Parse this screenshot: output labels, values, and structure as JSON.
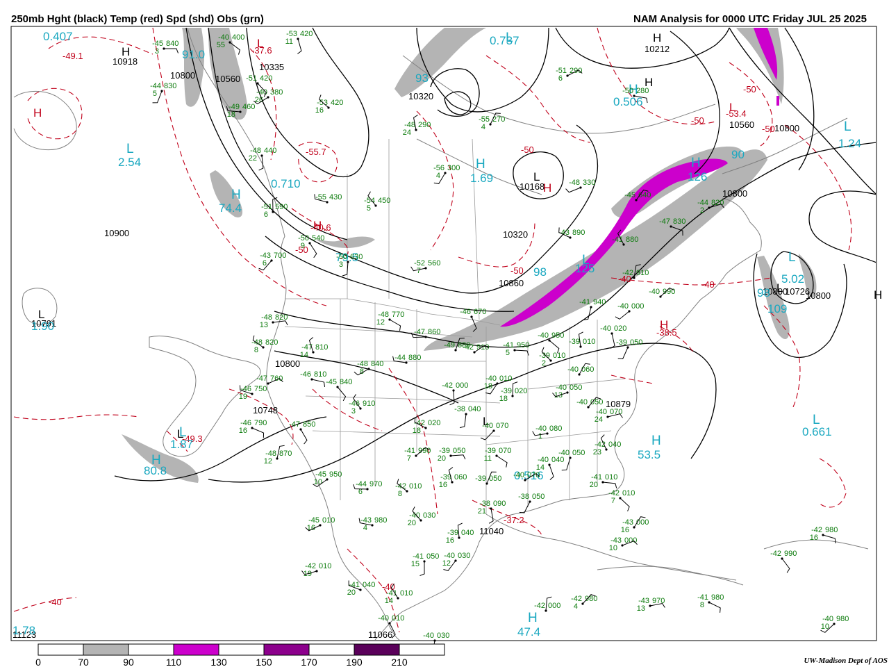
{
  "header": {
    "title_left": "250mb Hght (black) Temp (red) Spd (shd) Obs (grn)",
    "title_right": "NAM Analysis for 0000 UTC Friday  JUL 25 2025"
  },
  "credit": "UW-Madison  Dept of AOS",
  "colors": {
    "height_contour": "#000000",
    "temperature_contour": "#c0001a",
    "speed_label": "#1aa8c0",
    "observation": "#0a7a0a",
    "speed_70_90": "#b4b4b4",
    "speed_110_130": "#cc00cc",
    "speed_150_170": "#8c008c",
    "speed_190_210": "#5a005a",
    "coastline": "#808080"
  },
  "legend": {
    "ticks": [
      "0",
      "70",
      "90",
      "110",
      "130",
      "150",
      "170",
      "190",
      "210"
    ],
    "bins": [
      {
        "range": "70-90",
        "color": "#b4b4b4"
      },
      {
        "range": "110-130",
        "color": "#cc00cc"
      },
      {
        "range": "150-170",
        "color": "#8c008c"
      },
      {
        "range": "190-210",
        "color": "#5a005a"
      }
    ]
  },
  "height_labels": [
    "10918",
    "10800",
    "10335",
    "10212",
    "10320",
    "10560",
    "10800",
    "10168",
    "10320",
    "10800",
    "10860",
    "10900",
    "10800",
    "10726",
    "10800",
    "10791",
    "10800",
    "10748",
    "10879",
    "11040",
    "11123",
    "11066",
    "10560"
  ],
  "temp_labels": [
    "-49.1",
    "-37.6",
    "-53.4",
    "-50",
    "-50",
    "-50",
    "-55.7",
    "-40.6",
    "-50",
    "-50",
    "-40",
    "-40",
    "-38.5",
    "-49.3",
    "-37.2",
    "-40",
    "-40",
    "-50"
  ],
  "highs_lows": {
    "black": [
      "H",
      "H",
      "L",
      "L",
      "L",
      "H",
      "L",
      "H",
      "L"
    ],
    "red": [
      "H",
      "L",
      "H",
      "H",
      "L",
      "H"
    ],
    "cyan": [
      "H",
      "L",
      "H",
      "H",
      "L",
      "H",
      "L",
      "H",
      "L",
      "L",
      "H",
      "H",
      "L",
      "L"
    ]
  },
  "speed_labels": [
    "0.407",
    "91.0",
    "0.737",
    "93",
    "0.506",
    "2.54",
    "74.4",
    "0.710",
    "79.5",
    "1.69",
    "126",
    "90",
    "1.24",
    "98",
    "125",
    "98",
    "5.02",
    "109",
    "1.90",
    "1.87",
    "80.8",
    "0.661",
    "53.5",
    "0.516",
    "47.4",
    "1.78"
  ],
  "observations": [
    {
      "t": "-45",
      "h": "840",
      "d": "3"
    },
    {
      "t": "-40",
      "h": "400",
      "d": "55"
    },
    {
      "t": "-53",
      "h": "420",
      "d": "11"
    },
    {
      "t": "-44",
      "h": "830",
      "d": "5"
    },
    {
      "t": "-40",
      "h": "380",
      "d": "26"
    },
    {
      "t": "-49",
      "h": "460",
      "d": "18"
    },
    {
      "t": "-53",
      "h": "420",
      "d": "16"
    },
    {
      "t": "-48",
      "h": "290",
      "d": "24"
    },
    {
      "t": "-55",
      "h": "270",
      "d": "4"
    },
    {
      "t": "-51",
      "h": "290",
      "d": "6"
    },
    {
      "t": "-50",
      "h": "280",
      "d": ""
    },
    {
      "t": "-51",
      "h": "420",
      "d": ""
    },
    {
      "t": "-48",
      "h": "440",
      "d": "22"
    },
    {
      "t": "-56",
      "h": "300",
      "d": "4"
    },
    {
      "t": "-48",
      "h": "330",
      "d": ""
    },
    {
      "t": "-55",
      "h": "430",
      "d": ""
    },
    {
      "t": "-54",
      "h": "450",
      "d": "5"
    },
    {
      "t": "-51",
      "h": "590",
      "d": "6"
    },
    {
      "t": "-45",
      "h": "640",
      "d": ""
    },
    {
      "t": "-44",
      "h": "820",
      "d": "2"
    },
    {
      "t": "-47",
      "h": "830",
      "d": ""
    },
    {
      "t": "-50",
      "h": "540",
      "d": "9"
    },
    {
      "t": "-50",
      "h": "630",
      "d": "3"
    },
    {
      "t": "-43",
      "h": "700",
      "d": "6"
    },
    {
      "t": "-52",
      "h": "560",
      "d": "7"
    },
    {
      "t": "-43",
      "h": "890",
      "d": ""
    },
    {
      "t": "-41",
      "h": "880",
      "d": ""
    },
    {
      "t": "-42",
      "h": "910",
      "d": ""
    },
    {
      "t": "-40",
      "h": "990",
      "d": ""
    },
    {
      "t": "-48",
      "h": "820",
      "d": "13"
    },
    {
      "t": "-48",
      "h": "770",
      "d": "12"
    },
    {
      "t": "-46",
      "h": "670",
      "d": ""
    },
    {
      "t": "-41",
      "h": "940",
      "d": ""
    },
    {
      "t": "-40",
      "h": "000",
      "d": ""
    },
    {
      "t": "-47",
      "h": "860",
      "d": ""
    },
    {
      "t": "-48",
      "h": "820",
      "d": "8"
    },
    {
      "t": "-47",
      "h": "810",
      "d": "14"
    },
    {
      "t": "-49",
      "h": "880",
      "d": ""
    },
    {
      "t": "-42",
      "h": "910",
      "d": ""
    },
    {
      "t": "-41",
      "h": "950",
      "d": "5"
    },
    {
      "t": "-40",
      "h": "950",
      "d": ""
    },
    {
      "t": "-40",
      "h": "020",
      "d": ""
    },
    {
      "t": "-39",
      "h": "050",
      "d": ""
    },
    {
      "t": "-48",
      "h": "840",
      "d": "8"
    },
    {
      "t": "-44",
      "h": "880",
      "d": ""
    },
    {
      "t": "-39",
      "h": "010",
      "d": "2"
    },
    {
      "t": "-39",
      "h": "010",
      "d": ""
    },
    {
      "t": "-40",
      "h": "060",
      "d": ""
    },
    {
      "t": "-47",
      "h": "760",
      "d": ""
    },
    {
      "t": "-46",
      "h": "810",
      "d": ""
    },
    {
      "t": "-45",
      "h": "840",
      "d": ""
    },
    {
      "t": "-42",
      "h": "000",
      "d": ""
    },
    {
      "t": "-40",
      "h": "010",
      "d": "18"
    },
    {
      "t": "-40",
      "h": "050",
      "d": "13"
    },
    {
      "t": "-46",
      "h": "750",
      "d": "19"
    },
    {
      "t": "-46",
      "h": "910",
      "d": "3"
    },
    {
      "t": "-39",
      "h": "020",
      "d": "18"
    },
    {
      "t": "-40",
      "h": "050",
      "d": ""
    },
    {
      "t": "-40",
      "h": "070",
      "d": "24"
    },
    {
      "t": "-46",
      "h": "790",
      "d": "16"
    },
    {
      "t": "-47",
      "h": "850",
      "d": ""
    },
    {
      "t": "-38",
      "h": "040",
      "d": ""
    },
    {
      "t": "-40",
      "h": "070",
      "d": ""
    },
    {
      "t": "-40",
      "h": "080",
      "d": "1"
    },
    {
      "t": "-42",
      "h": "020",
      "d": "18"
    },
    {
      "t": "-42",
      "h": "040",
      "d": "23"
    },
    {
      "t": "-48",
      "h": "870",
      "d": "12"
    },
    {
      "t": "-41",
      "h": "990",
      "d": "7"
    },
    {
      "t": "-39",
      "h": "050",
      "d": "20"
    },
    {
      "t": "-39",
      "h": "070",
      "d": "11"
    },
    {
      "t": "-40",
      "h": "040",
      "d": "14"
    },
    {
      "t": "-40",
      "h": "050",
      "d": ""
    },
    {
      "t": "-45",
      "h": "950",
      "d": "10"
    },
    {
      "t": "-44",
      "h": "970",
      "d": "6"
    },
    {
      "t": "-42",
      "h": "010",
      "d": "8"
    },
    {
      "t": "-39",
      "h": "060",
      "d": "16"
    },
    {
      "t": "-39",
      "h": "050",
      "d": ""
    },
    {
      "t": "-40",
      "h": "070",
      "d": ""
    },
    {
      "t": "-41",
      "h": "010",
      "d": "20"
    },
    {
      "t": "-42",
      "h": "010",
      "d": "7"
    },
    {
      "t": "-38",
      "h": "090",
      "d": "21"
    },
    {
      "t": "-38",
      "h": "050",
      "d": ""
    },
    {
      "t": "-45",
      "h": "010",
      "d": "16"
    },
    {
      "t": "-43",
      "h": "980",
      "d": "4"
    },
    {
      "t": "-40",
      "h": "030",
      "d": "20"
    },
    {
      "t": "-39",
      "h": "040",
      "d": "16"
    },
    {
      "t": "-43",
      "h": "000",
      "d": "16"
    },
    {
      "t": "-43",
      "h": "000",
      "d": "10"
    },
    {
      "t": "-42",
      "h": "980",
      "d": "16"
    },
    {
      "t": "-42",
      "h": "990",
      "d": ""
    },
    {
      "t": "-41",
      "h": "050",
      "d": "15"
    },
    {
      "t": "-40",
      "h": "030",
      "d": "12"
    },
    {
      "t": "-42",
      "h": "010",
      "d": "19"
    },
    {
      "t": "-41",
      "h": "040",
      "d": "20"
    },
    {
      "t": "-41",
      "h": "010",
      "d": "14"
    },
    {
      "t": "-42",
      "h": "000",
      "d": ""
    },
    {
      "t": "-42",
      "h": "980",
      "d": "4"
    },
    {
      "t": "-43",
      "h": "970",
      "d": "13"
    },
    {
      "t": "-41",
      "h": "980",
      "d": "8"
    },
    {
      "t": "-40",
      "h": "010",
      "d": ""
    },
    {
      "t": "-40",
      "h": "030",
      "d": ""
    },
    {
      "t": "-40",
      "h": "980",
      "d": "10"
    }
  ]
}
